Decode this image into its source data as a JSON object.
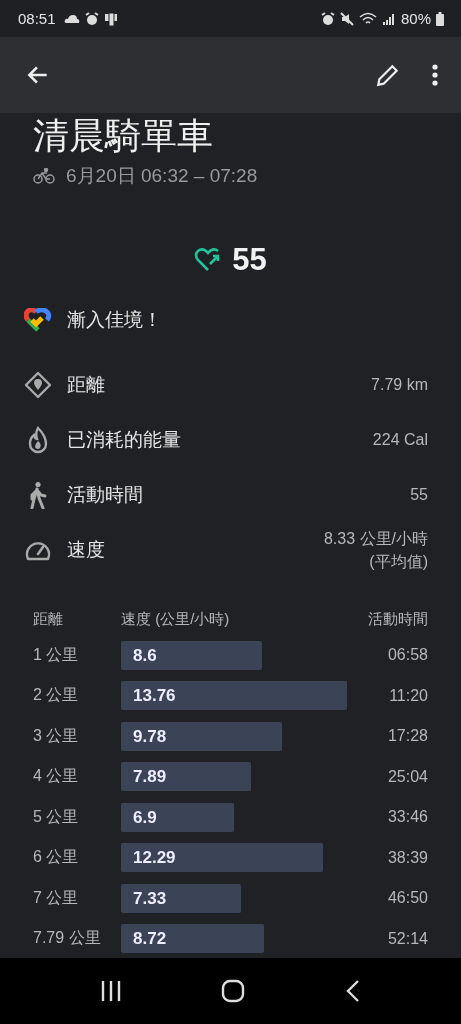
{
  "status_bar": {
    "time": "08:51",
    "battery": "80%"
  },
  "title": "清晨騎單車",
  "date_range": "6月20日 06:32 – 07:28",
  "heart_points": "55",
  "message": "漸入佳境！",
  "stats": [
    {
      "kind": "distance",
      "label": "距離",
      "value": "7.79 km"
    },
    {
      "kind": "energy",
      "label": "已消耗的能量",
      "value": "224 Cal"
    },
    {
      "kind": "active",
      "label": "活動時間",
      "value": "55"
    },
    {
      "kind": "speed",
      "label": "速度",
      "value": "8.33 公里/小時",
      "note": "(平均值)"
    }
  ],
  "splits": {
    "columns": [
      "距離",
      "速度 (公里/小時)",
      "活動時間"
    ],
    "rows": [
      {
        "distance": "1 公里",
        "speed": "8.6",
        "time": "06:58"
      },
      {
        "distance": "2 公里",
        "speed": "13.76",
        "time": "11:20"
      },
      {
        "distance": "3 公里",
        "speed": "9.78",
        "time": "17:28"
      },
      {
        "distance": "4 公里",
        "speed": "7.89",
        "time": "25:04"
      },
      {
        "distance": "5 公里",
        "speed": "6.9",
        "time": "33:46"
      },
      {
        "distance": "6 公里",
        "speed": "12.29",
        "time": "38:39"
      },
      {
        "distance": "7 公里",
        "speed": "7.33",
        "time": "46:50"
      },
      {
        "distance": "7.79 公里",
        "speed": "8.72",
        "time": "52:14"
      }
    ]
  }
}
